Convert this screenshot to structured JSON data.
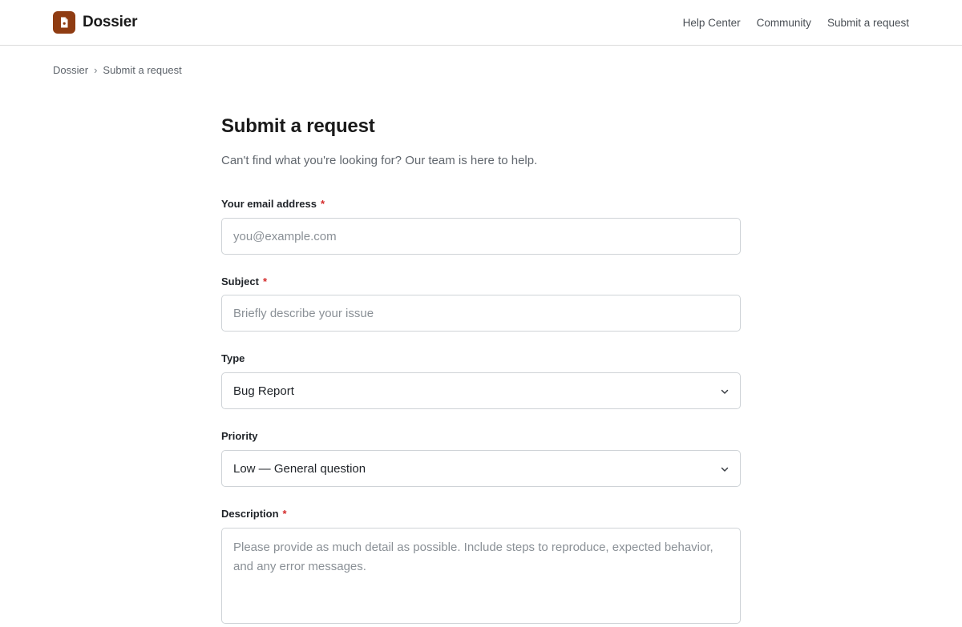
{
  "brand": {
    "name": "Dossier",
    "logo_icon": "document-icon",
    "accent_color": "#8f3c12"
  },
  "nav": {
    "items": [
      "Help Center",
      "Community",
      "Submit a request"
    ]
  },
  "breadcrumb": {
    "items": [
      "Dossier",
      "Submit a request"
    ],
    "separator": "›"
  },
  "page": {
    "title": "Submit a request",
    "subtitle": "Can't find what you're looking for? Our team is here to help."
  },
  "form": {
    "required_marker": "*",
    "email": {
      "label": "Your email address",
      "required": true,
      "placeholder": "you@example.com",
      "value": ""
    },
    "subject": {
      "label": "Subject",
      "required": true,
      "placeholder": "Briefly describe your issue",
      "value": ""
    },
    "type": {
      "label": "Type",
      "required": false,
      "selected": "Bug Report"
    },
    "priority": {
      "label": "Priority",
      "required": false,
      "selected": "Low — General question"
    },
    "description": {
      "label": "Description",
      "required": true,
      "placeholder": "Please provide as much detail as possible. Include steps to reproduce, expected behavior, and any error messages.",
      "value": ""
    }
  }
}
